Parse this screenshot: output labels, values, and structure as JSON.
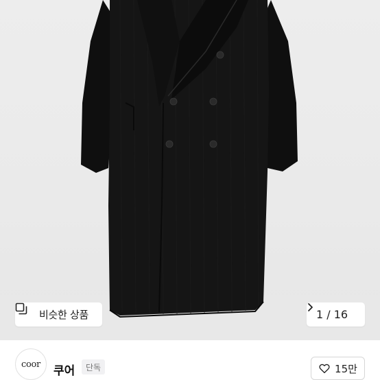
{
  "gallery": {
    "similar_button_label": "비슷한 상품",
    "page_indicator": "1 / 16",
    "current_page": 1,
    "total_pages": 16
  },
  "seller": {
    "avatar_text": "coor",
    "name": "쿠어",
    "badge": "단독"
  },
  "like": {
    "count_label": "15만"
  },
  "icons": {
    "similar": "stacked-squares-icon",
    "next": "chevron-right-icon",
    "like": "heart-outline-icon"
  },
  "colors": {
    "background": "#ebebeb",
    "coat": "#141414",
    "text": "#222222",
    "badge_bg": "#f1f1f3"
  }
}
